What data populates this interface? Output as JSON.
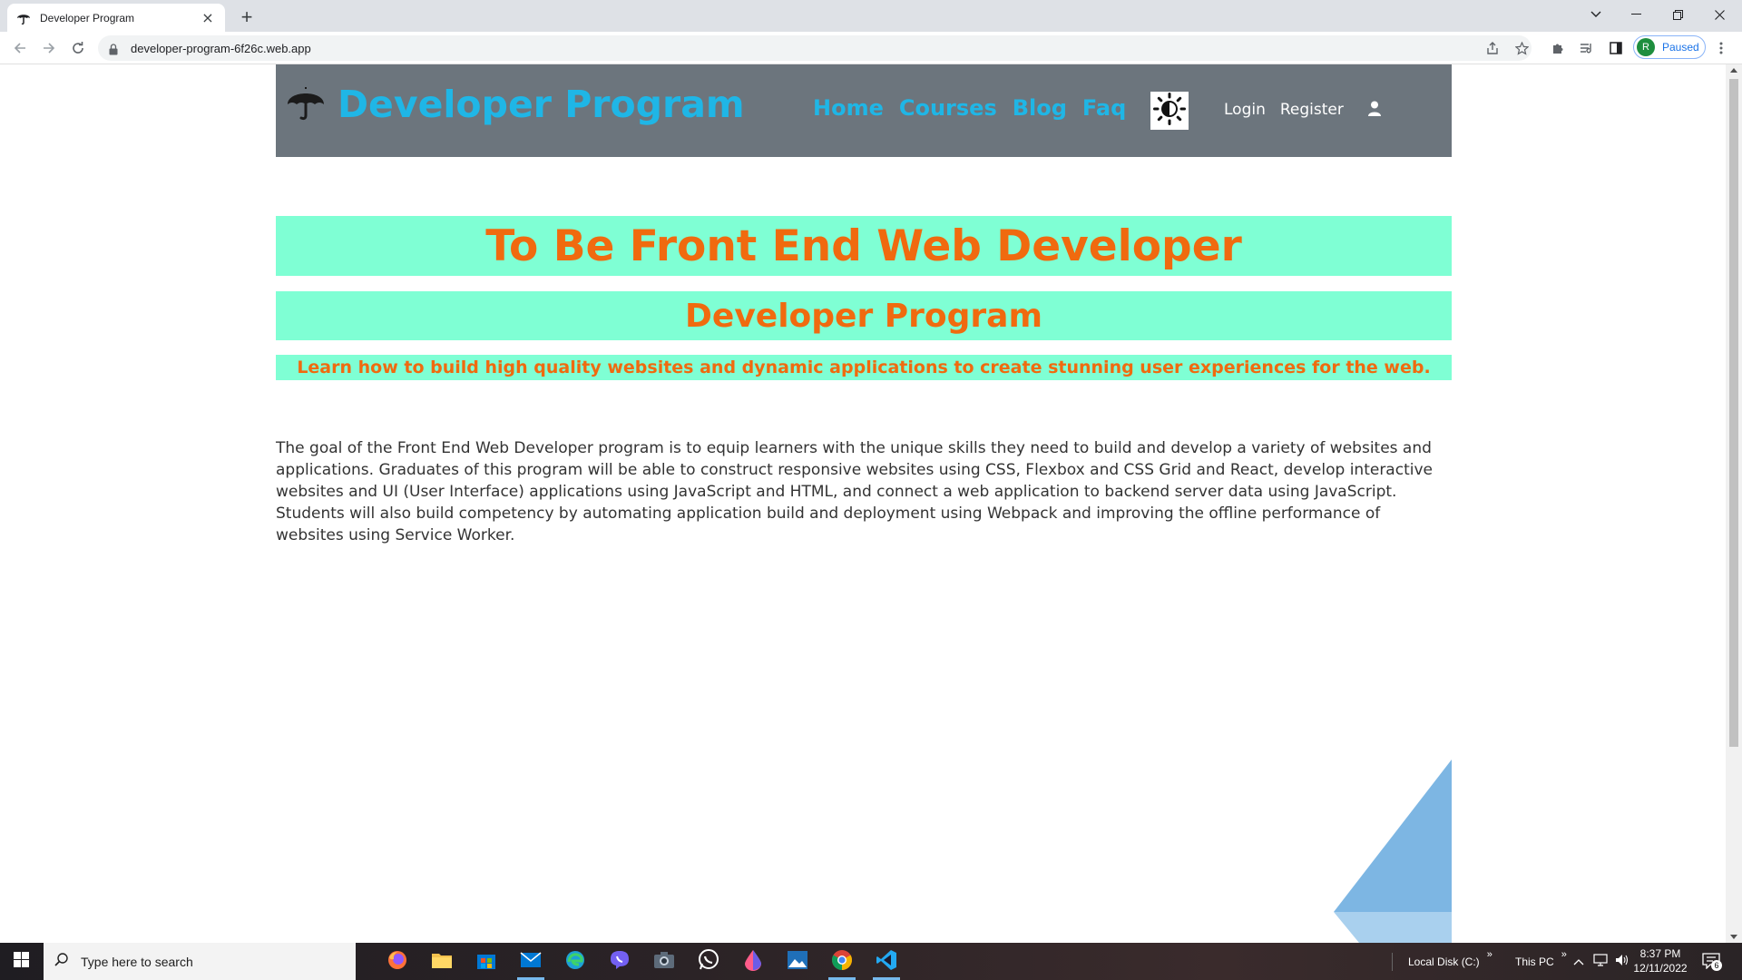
{
  "browser": {
    "tab_title": "Developer Program",
    "url": "developer-program-6f26c.web.app",
    "profile_initial": "R",
    "profile_status": "Paused"
  },
  "site": {
    "brand": "Developer Program",
    "nav": [
      "Home",
      "Courses",
      "Blog",
      "Faq"
    ],
    "login": "Login",
    "register": "Register"
  },
  "hero": {
    "title": "To Be Front End Web Developer",
    "subtitle": "Developer Program",
    "tagline": "Learn how to build high quality websites and dynamic applications to create stunning user experiences for the web."
  },
  "intro": {
    "text": "The goal of the Front End Web Developer program is to equip learners with the unique skills they need to build and develop a variety of websites and applications. Graduates of this program will be able to construct responsive websites using CSS, Flexbox and CSS Grid and React, develop interactive websites and UI (User Interface) applications using JavaScript and HTML, and connect a web application to backend server data using JavaScript. Students will also build competency by automating application build and deployment using Webpack and improving the offline performance of websites using Service Worker."
  },
  "taskbar": {
    "search_placeholder": "Type here to search",
    "tray_drive": "Local Disk (C:)",
    "tray_pc": "This PC",
    "time": "8:37 PM",
    "date": "12/11/2022",
    "notification_count": "6"
  },
  "colors": {
    "header_bg": "#6c757d",
    "brand_blue": "#1fb6e6",
    "band_bg": "#7fffd4",
    "band_text": "#f06a0f"
  }
}
